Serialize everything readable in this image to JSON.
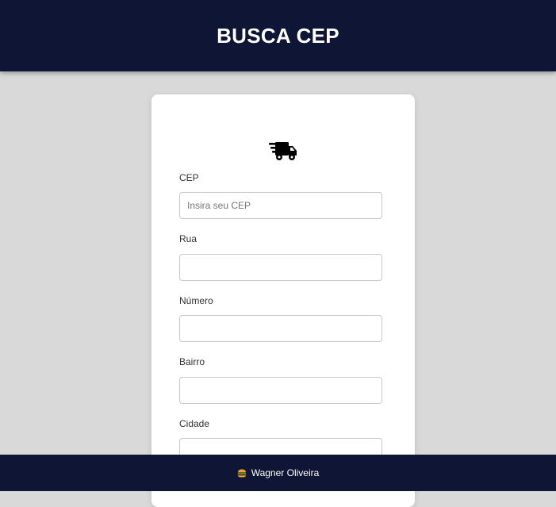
{
  "header": {
    "title": "BUSCA CEP"
  },
  "form": {
    "icon": "truck-icon",
    "fields": [
      {
        "label": "CEP",
        "value": "",
        "placeholder": "Insira seu CEP"
      },
      {
        "label": "Rua",
        "value": "",
        "placeholder": ""
      },
      {
        "label": "Número",
        "value": "",
        "placeholder": ""
      },
      {
        "label": "Bairro",
        "value": "",
        "placeholder": ""
      },
      {
        "label": "Cidade",
        "value": "",
        "placeholder": ""
      }
    ]
  },
  "footer": {
    "icon": "burger-icon",
    "text": "Wagner Oliveira"
  },
  "colors": {
    "header_bg": "#0f1535",
    "page_bg": "#d9d9d9",
    "card_bg": "#ffffff"
  }
}
